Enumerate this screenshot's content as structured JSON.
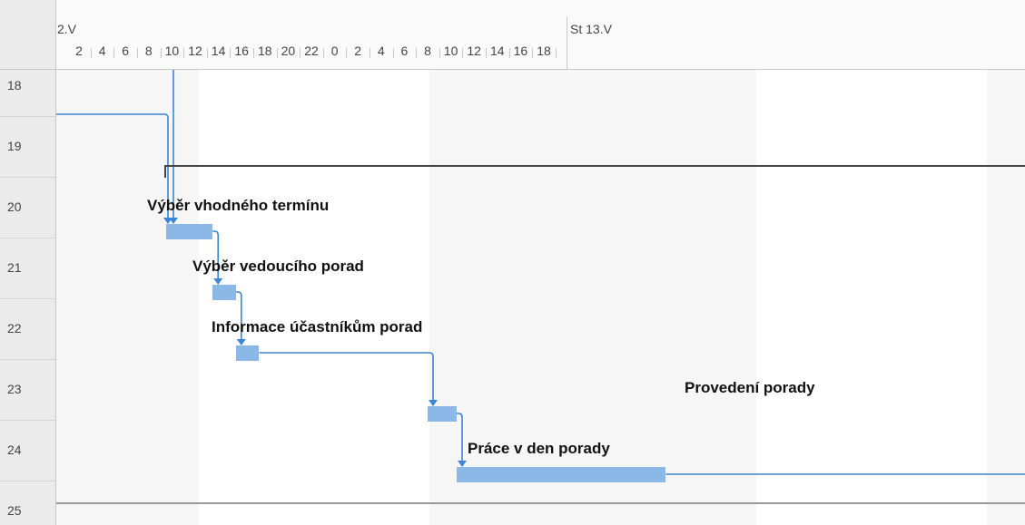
{
  "timescale": {
    "days": [
      "2.V",
      "St 13.V"
    ],
    "hours": [
      "2",
      "4",
      "6",
      "8",
      "10",
      "12",
      "14",
      "16",
      "18",
      "20",
      "22",
      "0",
      "2",
      "4",
      "6",
      "8",
      "10",
      "12",
      "14",
      "16",
      "18"
    ]
  },
  "rows": [
    "18",
    "19",
    "20",
    "21",
    "22",
    "23",
    "24",
    "25"
  ],
  "tasks": [
    {
      "name": "Výběr vhodného termínu",
      "start_hour": 9.5,
      "end_hour": 13.5
    },
    {
      "name": "Výběr vedoucího porad",
      "start_hour": 13.5,
      "end_hour": 15.5
    },
    {
      "name": "Informace účastníkům porad",
      "start_hour": 15.5,
      "end_hour": 17.5
    },
    {
      "name": "Provedení porady",
      "start_hour": 32.0,
      "end_hour": 34.5
    },
    {
      "name": "Práce v den porady",
      "start_hour": 34.5,
      "end_hour": 52.5
    }
  ],
  "colors": {
    "bar": "#8cb8e8",
    "link": "#3a86d4",
    "summary": "#444444",
    "nonworking": "#f6f6f6",
    "header": "#ebebeb"
  }
}
